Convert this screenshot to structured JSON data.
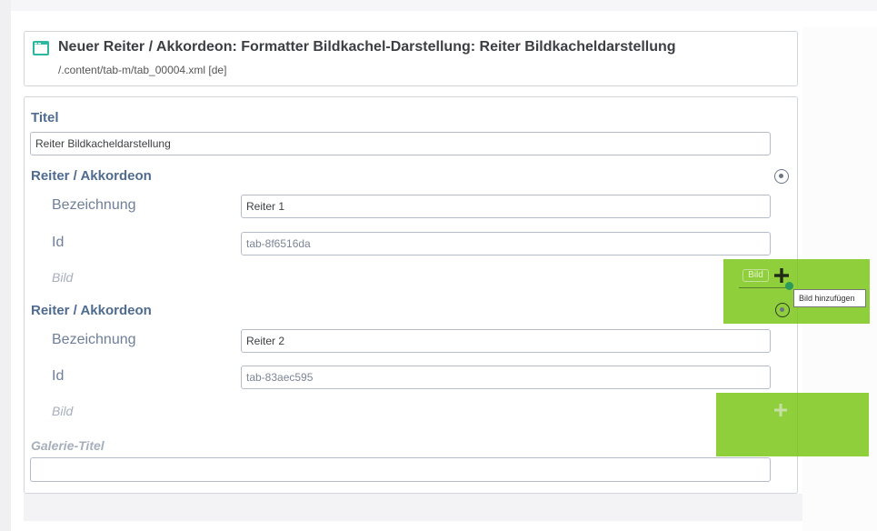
{
  "header": {
    "title": "Neuer Reiter / Akkordeon: Formatter Bildkachel-Darstellung: Reiter Bildkacheldarstellung",
    "path": "/.content/tab-m/tab_00004.xml [de]"
  },
  "form": {
    "titel": {
      "label": "Titel",
      "value": "Reiter Bildkacheldarstellung"
    },
    "sections": [
      {
        "label": "Reiter / Akkordeon",
        "bezeichnung_label": "Bezeichnung",
        "bezeichnung_value": "Reiter 1",
        "id_label": "Id",
        "id_value": "tab-8f6516da",
        "bild_label": "Bild"
      },
      {
        "label": "Reiter / Akkordeon",
        "bezeichnung_label": "Bezeichnung",
        "bezeichnung_value": "Reiter 2",
        "id_label": "Id",
        "id_value": "tab-83aec595",
        "bild_label": "Bild"
      }
    ],
    "galerie_titel": {
      "label": "Galerie-Titel",
      "value": ""
    }
  },
  "image_add": {
    "pill_label": "Bild",
    "tooltip": "Bild hinzufügen"
  },
  "colors": {
    "highlight": "#75c410",
    "label_blue": "#4f6b8f",
    "header_icon": "#2db7a0"
  },
  "icons": [
    "editor-window-icon",
    "section-menu-icon",
    "add-image-icon"
  ]
}
